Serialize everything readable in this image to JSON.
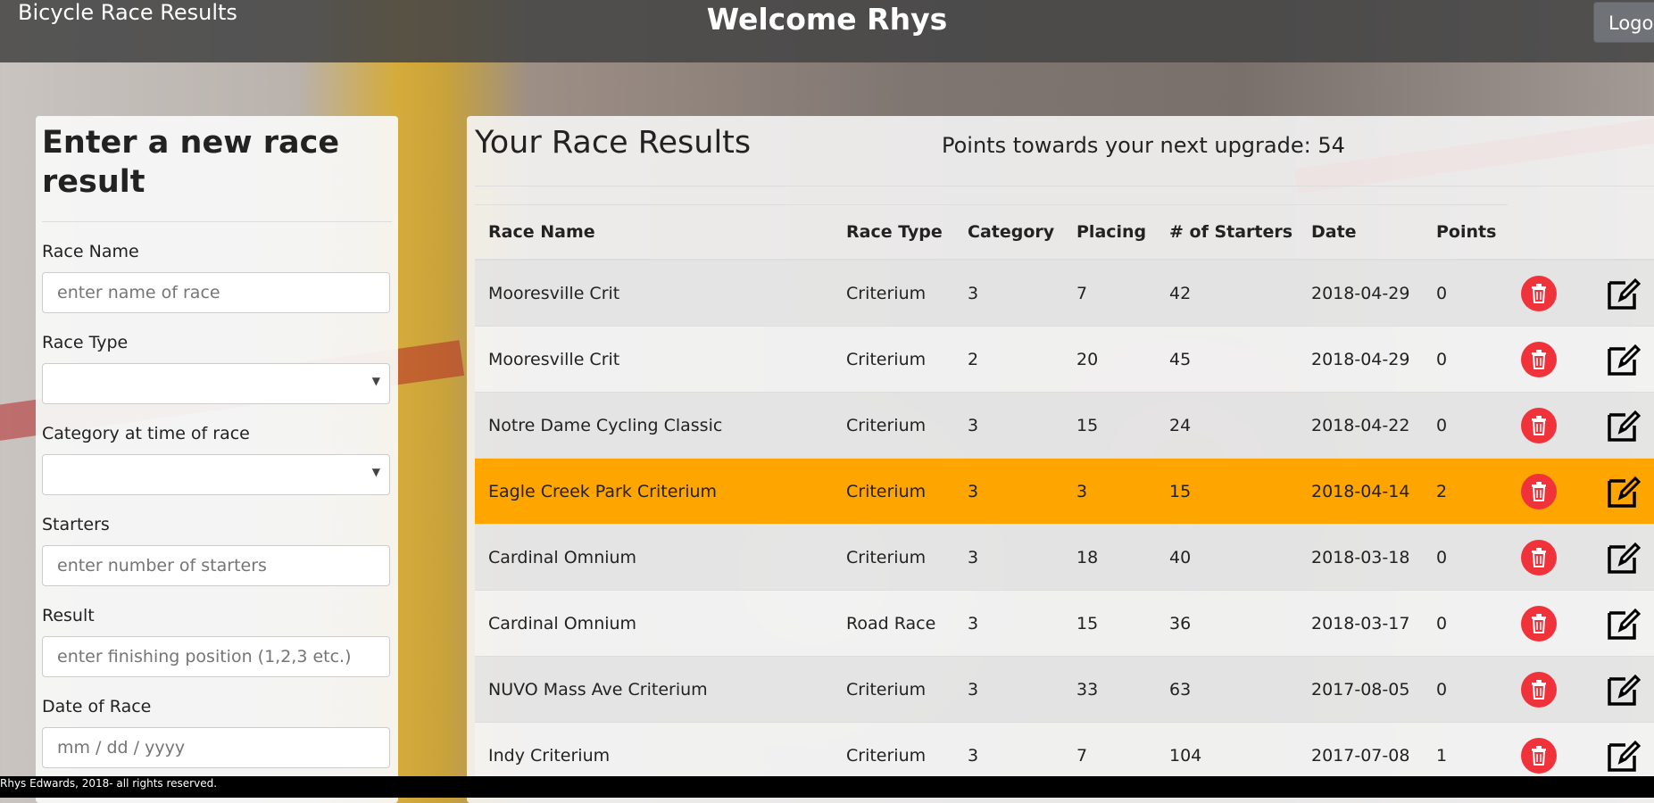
{
  "header": {
    "brand": "Bicycle Race Results",
    "welcome": "Welcome Rhys",
    "logout_label": "Logout"
  },
  "form": {
    "title": "Enter a new race result",
    "race_name": {
      "label": "Race Name",
      "placeholder": "enter name of race",
      "value": ""
    },
    "race_type": {
      "label": "Race Type",
      "value": ""
    },
    "category": {
      "label": "Category at time of race",
      "value": ""
    },
    "starters": {
      "label": "Starters",
      "placeholder": "enter number of starters",
      "value": ""
    },
    "result": {
      "label": "Result",
      "placeholder": "enter finishing position (1,2,3 etc.)",
      "value": ""
    },
    "date": {
      "label": "Date of Race",
      "placeholder": "mm / dd / yyyy",
      "value": ""
    }
  },
  "results": {
    "title": "Your Race Results",
    "points_text": "Points towards your next upgrade: 54",
    "columns": [
      "Race Name",
      "Race Type",
      "Category",
      "Placing",
      "# of Starters",
      "Date",
      "Points"
    ],
    "rows": [
      {
        "name": "Mooresville Crit",
        "type": "Criterium",
        "category": "3",
        "placing": "7",
        "starters": "42",
        "date": "2018-04-29",
        "points": "0"
      },
      {
        "name": "Mooresville Crit",
        "type": "Criterium",
        "category": "2",
        "placing": "20",
        "starters": "45",
        "date": "2018-04-29",
        "points": "0"
      },
      {
        "name": "Notre Dame Cycling Classic",
        "type": "Criterium",
        "category": "3",
        "placing": "15",
        "starters": "24",
        "date": "2018-04-22",
        "points": "0"
      },
      {
        "name": "Eagle Creek Park Criterium",
        "type": "Criterium",
        "category": "3",
        "placing": "3",
        "starters": "15",
        "date": "2018-04-14",
        "points": "2"
      },
      {
        "name": "Cardinal Omnium",
        "type": "Criterium",
        "category": "3",
        "placing": "18",
        "starters": "40",
        "date": "2018-03-18",
        "points": "0"
      },
      {
        "name": "Cardinal Omnium",
        "type": "Road Race",
        "category": "3",
        "placing": "15",
        "starters": "36",
        "date": "2018-03-17",
        "points": "0"
      },
      {
        "name": "NUVO Mass Ave Criterium",
        "type": "Criterium",
        "category": "3",
        "placing": "33",
        "starters": "63",
        "date": "2017-08-05",
        "points": "0"
      },
      {
        "name": "Indy Criterium",
        "type": "Criterium",
        "category": "3",
        "placing": "7",
        "starters": "104",
        "date": "2017-07-08",
        "points": "1"
      }
    ],
    "highlight_color": "#ffa500",
    "delete_icon": "trash-icon",
    "edit_icon": "edit-icon"
  },
  "footer": {
    "text": "Rhys Edwards, 2018- all rights reserved."
  }
}
